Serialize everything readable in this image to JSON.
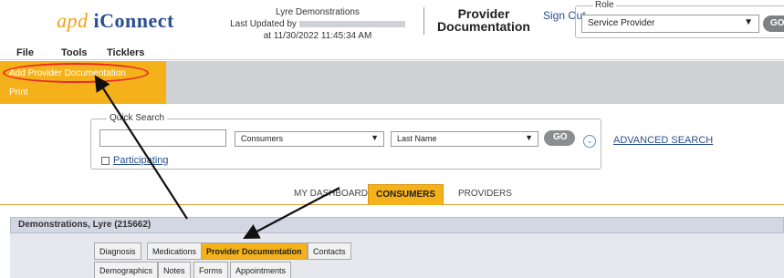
{
  "header": {
    "logo_apd": "apd",
    "logo_iconnect": "iConnect",
    "user_name": "Lyre Demonstrations",
    "last_updated_prefix": "Last Updated by",
    "last_updated_at": "at 11/30/2022 11:45:34 AM",
    "page_title_line1": "Provider",
    "page_title_line2": "Documentation",
    "sign_out": "Sign Out",
    "role_legend": "Role",
    "role_value": "Service Provider",
    "go_label": "GO"
  },
  "menu": {
    "items": [
      "File",
      "Tools",
      "Ticklers"
    ]
  },
  "actions": {
    "items": [
      "Add Provider Documentation",
      "Print"
    ]
  },
  "quick_search": {
    "legend": "Quick Search",
    "input_value": "",
    "type_value": "Consumers",
    "field_value": "Last Name",
    "go_label": "GO",
    "expand_icon": "⌄",
    "advanced_link": "ADVANCED SEARCH",
    "checkbox_label": "Participating"
  },
  "main_tabs": [
    "MY DASHBOARD",
    "CONSUMERS",
    "PROVIDERS"
  ],
  "consumer": {
    "title": "Demonstrations, Lyre (215662)"
  },
  "sub_tabs_row1": [
    "Diagnosis",
    "Medications",
    "Provider Documentation",
    "Contacts"
  ],
  "sub_tabs_row2": [
    "Demographics",
    "Notes",
    "Forms",
    "Appointments"
  ],
  "colors": {
    "accent_orange": "#f4b119",
    "highlight_red": "#e8262b",
    "link_blue": "#2a4e8f",
    "band_gray": "#cfd1d5"
  }
}
